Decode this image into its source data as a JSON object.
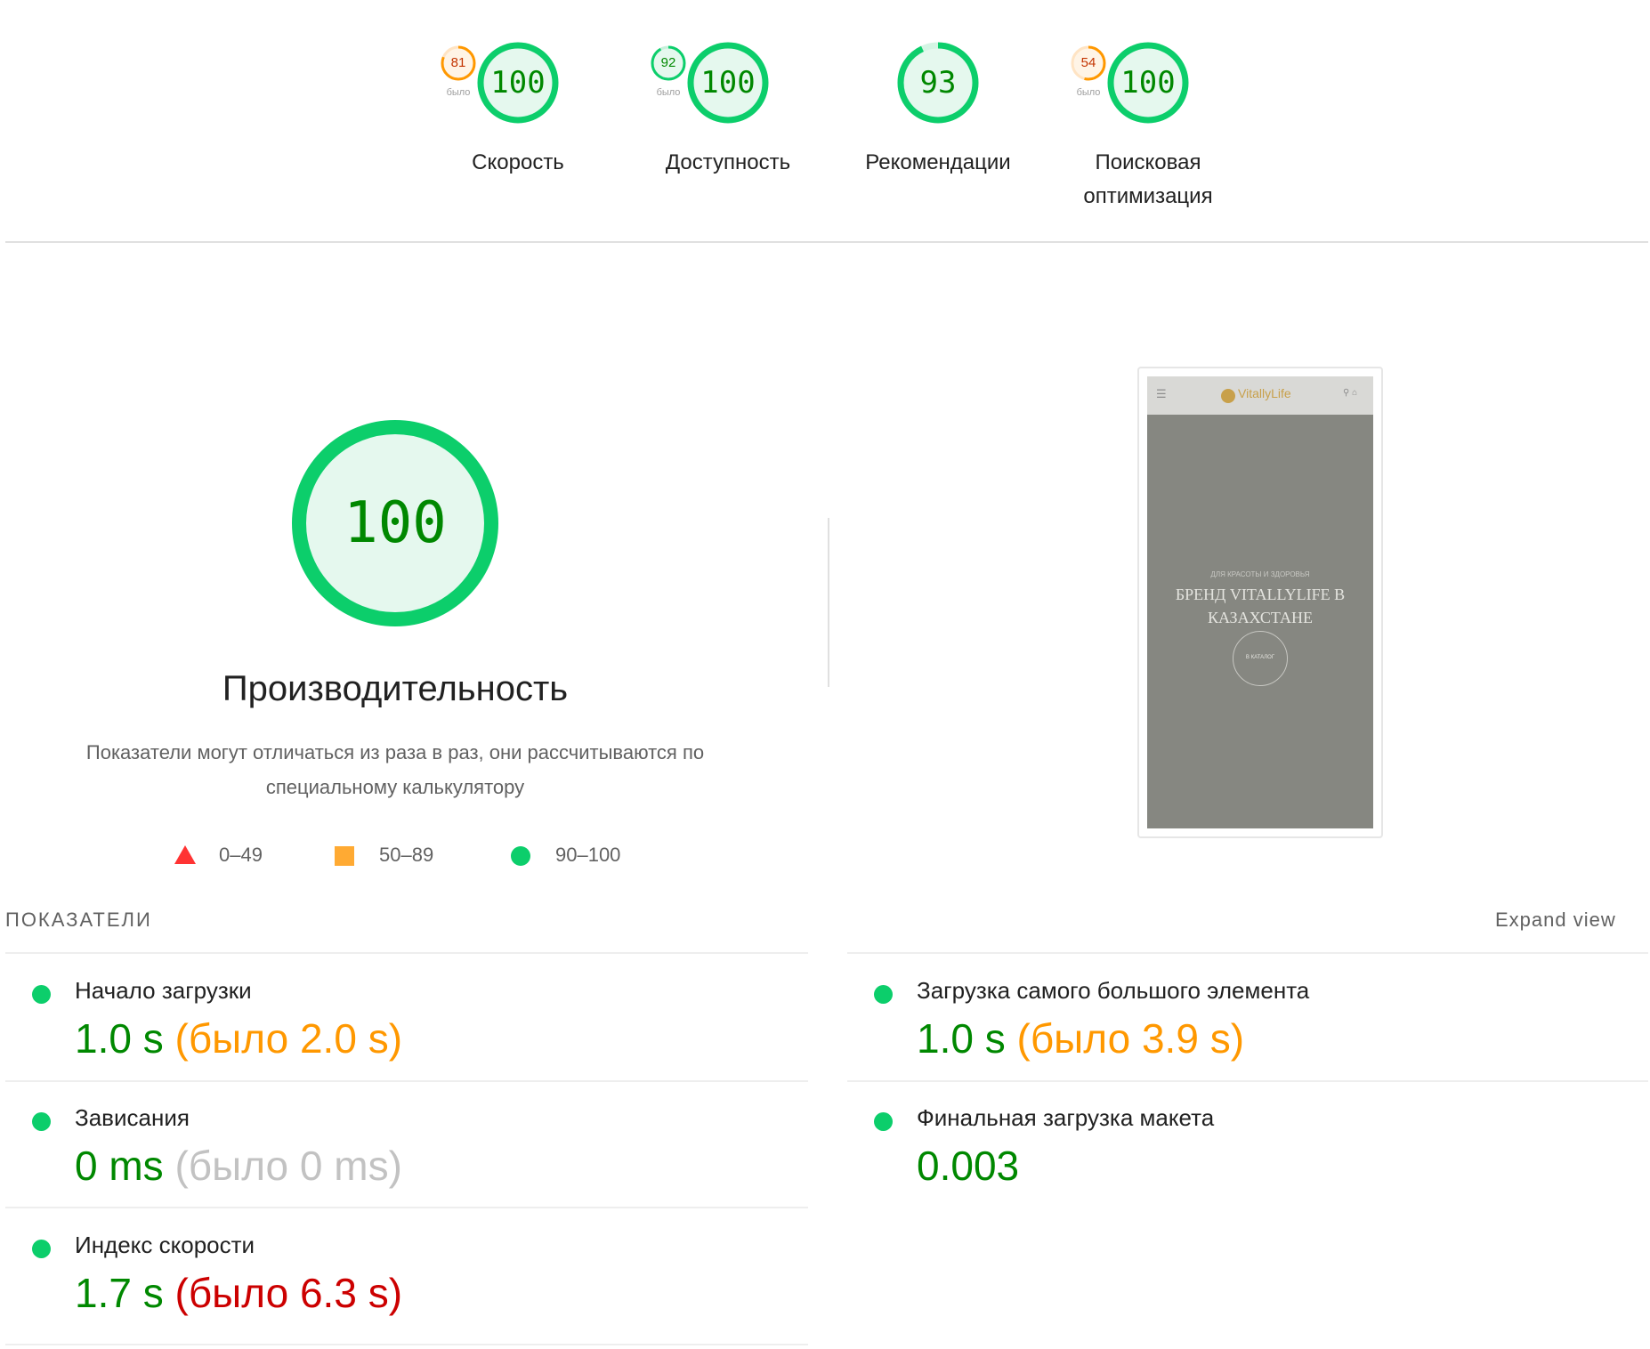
{
  "summary": {
    "prev_caption": "было",
    "gauges": [
      {
        "label": "Скорость",
        "score": "100",
        "prev": "81",
        "prev_color": "#ff9800"
      },
      {
        "label": "Доступность",
        "score": "100",
        "prev": "92",
        "prev_color": "#0cce6b"
      },
      {
        "label": "Рекомендации",
        "score": "93",
        "prev": "",
        "prev_color": ""
      },
      {
        "label": "Поисковая оптимизация",
        "score": "100",
        "prev": "54",
        "prev_color": "#ff9800"
      }
    ]
  },
  "performance": {
    "score": "100",
    "title": "Производительность",
    "description": "Показатели могут отличаться из раза в раз, они рассчитываются по специальному калькулятору",
    "legend": [
      {
        "range": "0–49",
        "shape": "triangle",
        "color": "#ff3333"
      },
      {
        "range": "50–89",
        "shape": "square",
        "color": "#ffaa33"
      },
      {
        "range": "90–100",
        "shape": "circle",
        "color": "#0cce6b"
      }
    ]
  },
  "preview": {
    "logo": "VitallyLife",
    "kicker": "ДЛЯ КРАСОТЫ И ЗДОРОВЬЯ",
    "headline": "БРЕНД VITALLYLIFE В КАЗАХСТАНЕ",
    "button": "В КАТАЛОГ"
  },
  "metrics": {
    "section_title": "ПОКАЗАТЕЛИ",
    "expand_label": "Expand view",
    "items": [
      {
        "title": "Начало загрузки",
        "value": "1.0 s",
        "was": "(было 2.0 s)",
        "was_color": "orange"
      },
      {
        "title": "Загрузка самого большого элемента",
        "value": "1.0 s",
        "was": "(было 3.9 s)",
        "was_color": "orange"
      },
      {
        "title": "Зависания",
        "value": "0 ms",
        "was": "(было 0 ms)",
        "was_color": "gray"
      },
      {
        "title": "Финальная загрузка макета",
        "value": "0.003",
        "was": "",
        "was_color": ""
      },
      {
        "title": "Индекс скорости",
        "value": "1.7 s",
        "was": "(было 6.3 s)",
        "was_color": "red"
      }
    ]
  },
  "colors": {
    "pass": "#0cce6b",
    "pass_text": "#008800",
    "average": "#ff9800",
    "fail": "#cc0000"
  }
}
